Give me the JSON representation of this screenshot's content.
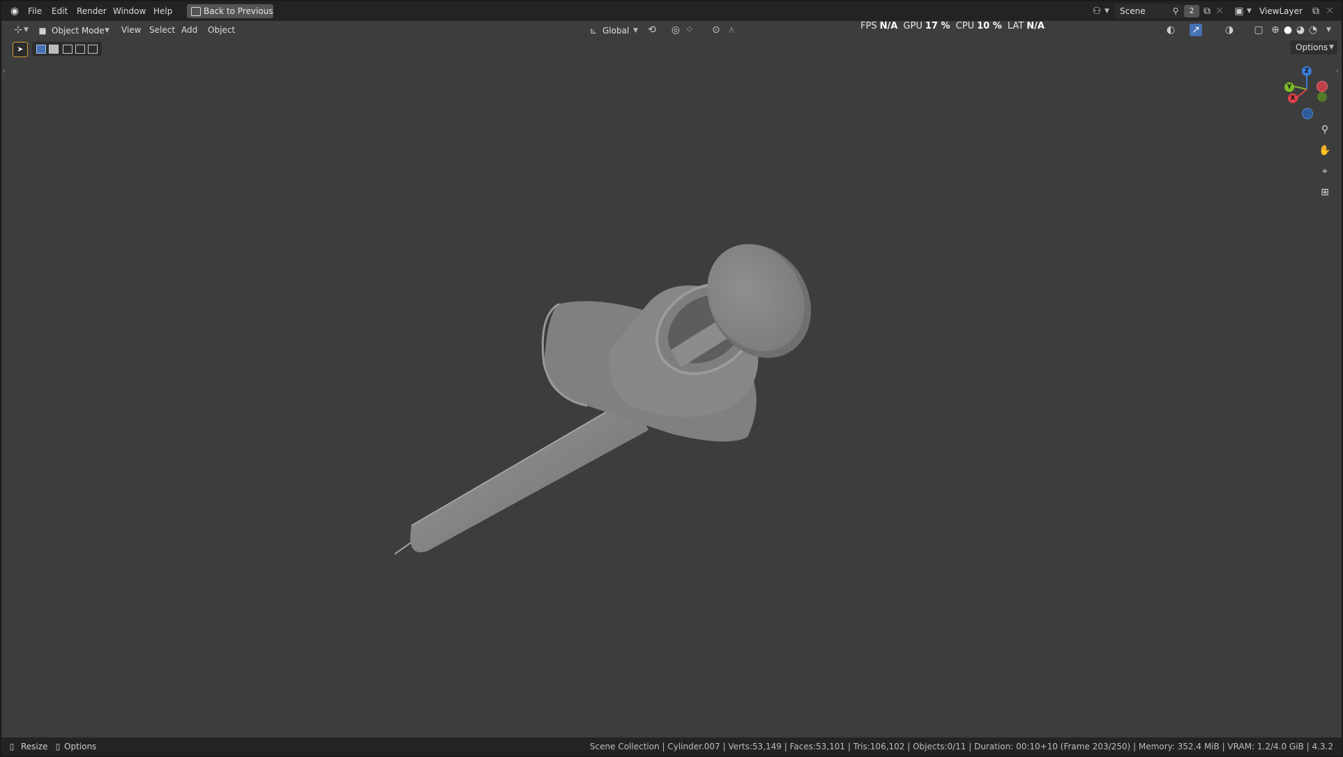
{
  "menu": {
    "items": [
      "File",
      "Edit",
      "Render",
      "Window",
      "Help"
    ],
    "back_button": "Back to Previous"
  },
  "scene": {
    "name": "Scene",
    "count": "2"
  },
  "view_layer": {
    "name": "ViewLayer"
  },
  "header": {
    "mode": "Object Mode",
    "view": "View",
    "select": "Select",
    "add": "Add",
    "object": "Object",
    "orientation": "Global",
    "options": "Options"
  },
  "perf": {
    "fps_label": "FPS",
    "fps_value": "N/A",
    "gpu_label": "GPU",
    "gpu_value": "17 %",
    "cpu_label": "CPU",
    "cpu_value": "10 %",
    "lat_label": "LAT",
    "lat_value": "N/A"
  },
  "gizmo": {
    "z": "Z",
    "y": "Y",
    "x": "X"
  },
  "status": {
    "resize": "Resize",
    "options": "Options",
    "info": "Scene Collection | Cylinder.007 | Verts:53,149 | Faces:53,101 | Tris:106,102 | Objects:0/11 | Duration: 00:10+10 (Frame 203/250) | Memory: 352.4 MiB | VRAM: 1.2/4.0 GiB | 4.3.2"
  },
  "colors": {
    "viewport_bg": "#3d3d3d",
    "header_bg": "#232323",
    "accent_blue": "#4772b3",
    "axis_x": "#e0424a",
    "axis_y": "#7cba2a",
    "axis_z": "#3a7cd9",
    "model_gray": "#8a8a8a"
  },
  "icons": [
    "blender-logo-icon",
    "editor-type-icon",
    "select-box-icon",
    "transform-orientation-icon",
    "pivot-icon",
    "snap-icon",
    "proportional-edit-icon",
    "visibility-icon",
    "gizmo-icon",
    "overlay-icon",
    "xray-icon",
    "shading-wireframe-icon",
    "shading-solid-icon",
    "shading-material-icon",
    "shading-rendered-icon",
    "zoom-icon",
    "pan-hand-icon",
    "camera-icon",
    "grid-icon"
  ]
}
